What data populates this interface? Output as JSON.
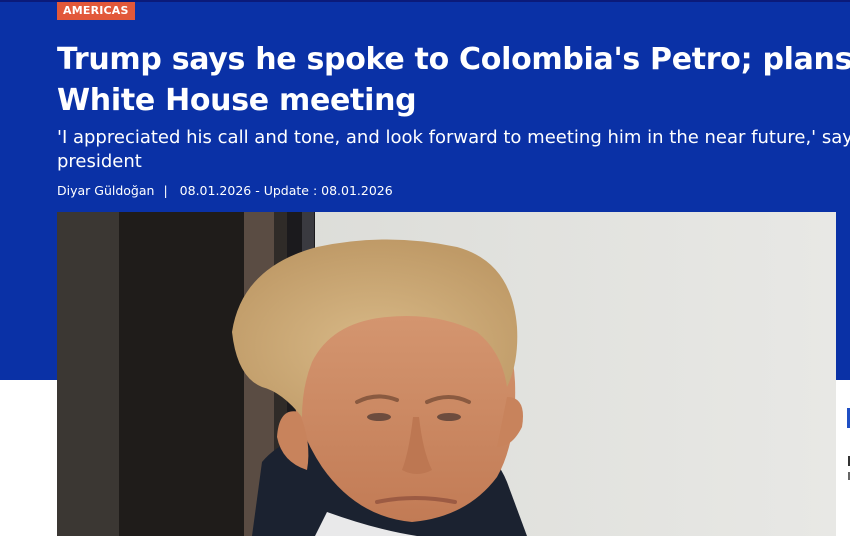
{
  "article": {
    "category": "AMERICAS",
    "headline": "Trump says he spoke to Colombia's Petro; plans White House meeting",
    "subtitle": "'I appreciated his call and tone, and look forward to meeting him in the near future,' says US president",
    "author": "Diyar Güldoğan",
    "byline_separator": "|",
    "date": "08.01.2026 - Update : 08.01.2026"
  },
  "image": {
    "subject": "portrait-photo"
  },
  "colors": {
    "header_background": "#0a31a6",
    "category_badge": "#e2583a",
    "text_on_header": "#ffffff"
  }
}
